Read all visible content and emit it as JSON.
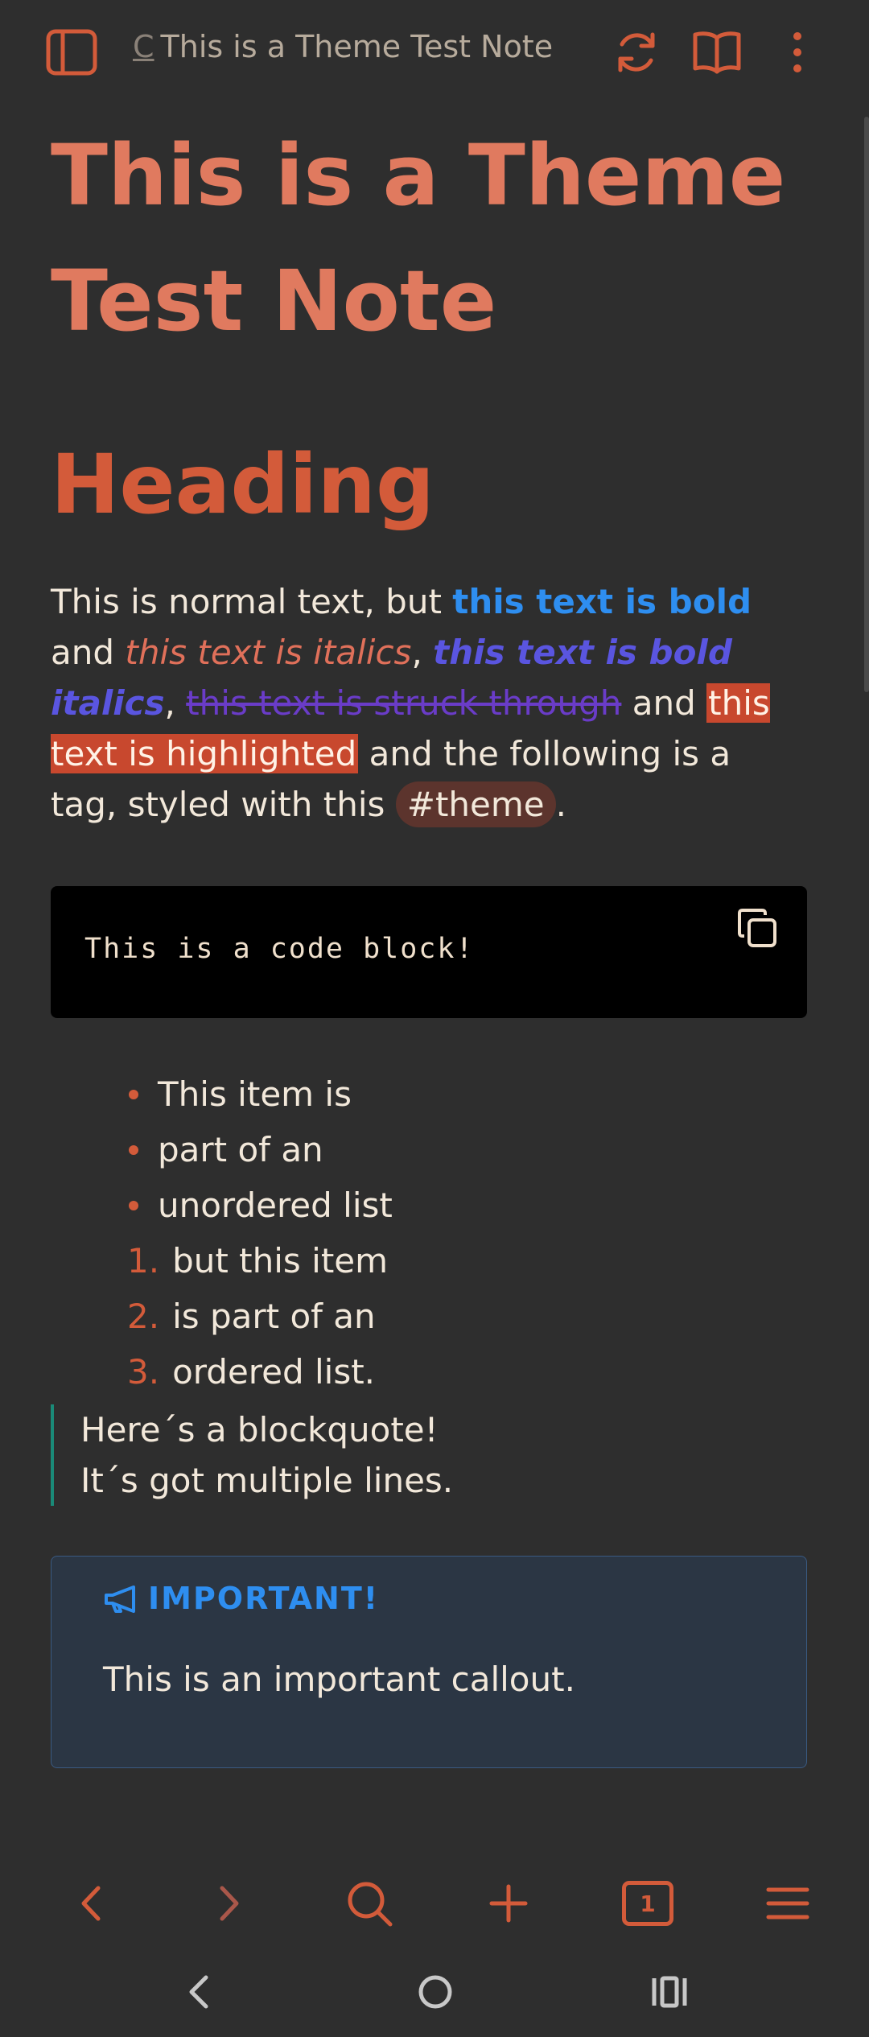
{
  "header": {
    "cursor_char": "C",
    "title": "This is a Theme Test Note"
  },
  "note": {
    "title": "This is a Theme Test Note",
    "heading": "Heading",
    "para": {
      "t1": "This is normal text, but ",
      "bold": "this text is bold",
      "t2": " and ",
      "italics": "this text is italics",
      "t3": ", ",
      "bold_italics": "this text is bold italics",
      "t4": ", ",
      "struck": "this text is struck through",
      "t5": " and ",
      "highlighted": "this text is highlighted",
      "t6": " and the following is a tag, styled with this ",
      "tag": "#theme",
      "t7": "."
    },
    "code": "This is a code block!",
    "unordered": [
      "This item is",
      "part of an",
      "unordered list"
    ],
    "ordered": [
      {
        "num": "1.",
        "text": "but this item"
      },
      {
        "num": "2.",
        "text": "is part of an"
      },
      {
        "num": "3.",
        "text": "ordered list."
      }
    ],
    "blockquote": [
      "Here´s a blockquote!",
      "It´s got multiple lines."
    ],
    "callout": {
      "title": "IMPORTANT!",
      "body": "This is an important callout."
    }
  },
  "navbar": {
    "tab_count": "1"
  },
  "colors": {
    "accent": "#d35b3a",
    "title": "#e07a5f",
    "bold": "#2e8ef0",
    "bold_italics": "#5a55e0",
    "struck": "#6a3cc8",
    "highlight": "#c8482e",
    "background": "#2e2e2e"
  }
}
